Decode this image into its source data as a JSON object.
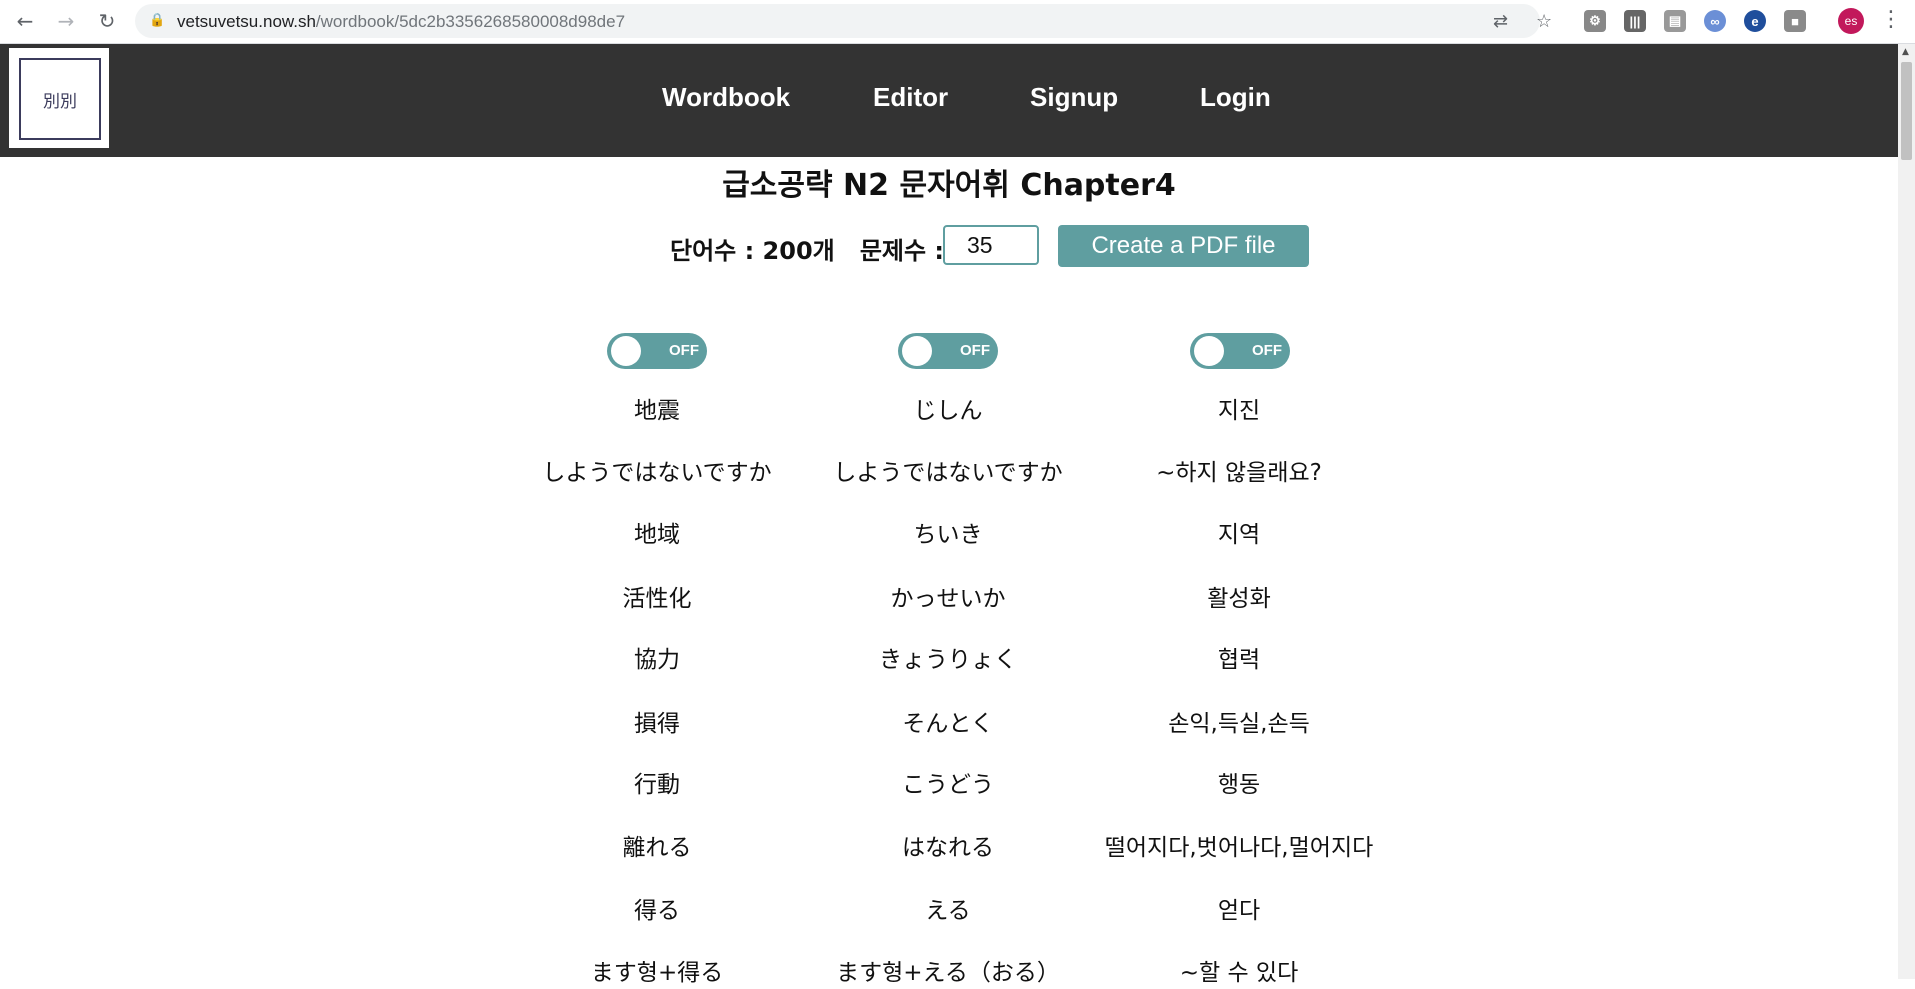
{
  "browser": {
    "url_host": "vetsuvetsu.now.sh",
    "url_path": "/wordbook/5dc2b3356268580008d98de7",
    "profile_initials": "es"
  },
  "header": {
    "logo_text": "別別",
    "nav": [
      "Wordbook",
      "Editor",
      "Signup",
      "Login"
    ]
  },
  "main": {
    "title": "급소공략 N2 문자어휘 Chapter4",
    "word_count_label": "단어수 : 200개",
    "question_count_label": "문제수 :",
    "question_count_value": "35",
    "pdf_button": "Create a PDF file",
    "toggles": [
      "OFF",
      "OFF",
      "OFF"
    ]
  },
  "words": [
    [
      "地震",
      "じしん",
      "지진"
    ],
    [
      "しようではないですか",
      "しようではないですか",
      "~하지 않을래요?"
    ],
    [
      "地域",
      "ちいき",
      "지역"
    ],
    [
      "活性化",
      "かっせいか",
      "활성화"
    ],
    [
      "協力",
      "きょうりょく",
      "협력"
    ],
    [
      "損得",
      "そんとく",
      "손익,득실,손득"
    ],
    [
      "行動",
      "こうどう",
      "행동"
    ],
    [
      "離れる",
      "はなれる",
      "떨어지다,벗어나다,멀어지다"
    ],
    [
      "得る",
      "える",
      "얻다"
    ],
    [
      "ます형+得る",
      "ます형+える（おる）",
      "~할 수 있다"
    ]
  ]
}
